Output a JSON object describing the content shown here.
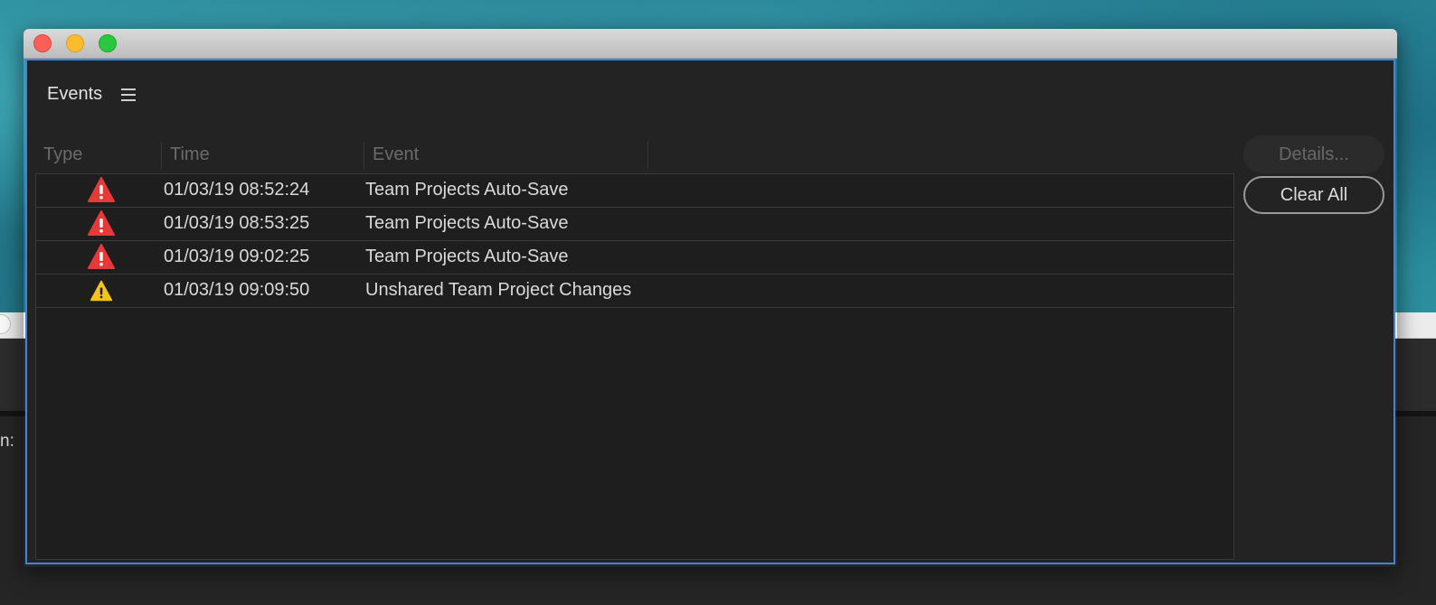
{
  "panel": {
    "title": "Events"
  },
  "columns": {
    "type": "Type",
    "time": "Time",
    "event": "Event"
  },
  "rows": [
    {
      "type": "error",
      "time": "01/03/19 08:52:24",
      "event": "Team Projects Auto-Save"
    },
    {
      "type": "error",
      "time": "01/03/19 08:53:25",
      "event": "Team Projects Auto-Save"
    },
    {
      "type": "error",
      "time": "01/03/19 09:02:25",
      "event": "Team Projects Auto-Save"
    },
    {
      "type": "warning",
      "time": "01/03/19 09:09:50",
      "event": "Unshared Team Project Changes"
    }
  ],
  "buttons": {
    "details": "Details...",
    "clear_all": "Clear All"
  },
  "background": {
    "partial_text": "n: "
  },
  "colors": {
    "error": "#e5393a",
    "warning": "#f2c31c",
    "focus_border": "#3d86d8"
  },
  "icons": {
    "error": "error-warning-triangle-icon",
    "warning": "caution-triangle-icon",
    "menu": "hamburger-menu-icon"
  }
}
